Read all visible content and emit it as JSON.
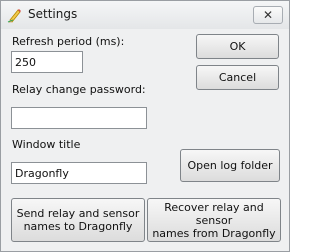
{
  "window": {
    "title": "Settings",
    "close_glyph": "✕",
    "title_icon": "pencil-icon"
  },
  "fields": {
    "refresh_label": "Refresh period (ms):",
    "refresh_value": "250",
    "password_label": "Relay change password:",
    "password_value": "",
    "window_title_label": "Window title",
    "window_title_value": "Dragonfly"
  },
  "buttons": {
    "ok": "OK",
    "cancel": "Cancel",
    "open_log": "Open log folder",
    "send_names": "Send relay and sensor\nnames to Dragonfly",
    "recover_names": "Recover relay and sensor\nnames from Dragonfly"
  }
}
